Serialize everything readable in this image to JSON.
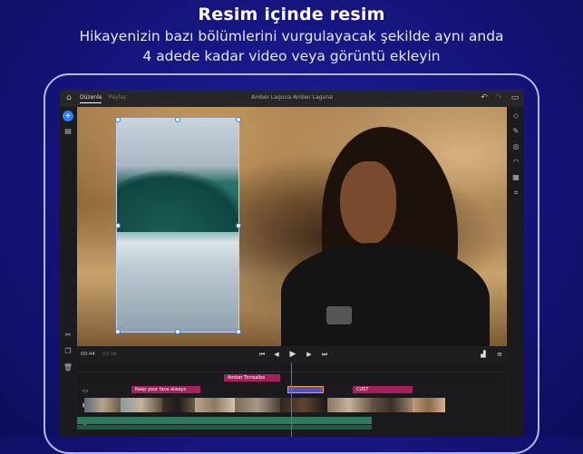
{
  "headline": {
    "title": "Resim içinde resim",
    "line1": "Hikayenizin bazı bölümlerini vurgulayacak şekilde aynı anda",
    "line2": "4 adede kadar video veya görüntü ekleyin"
  },
  "app": {
    "tabs": [
      {
        "label": "Düzenle",
        "active": true
      },
      {
        "label": "Paylaş",
        "active": false
      }
    ],
    "project_title": "Amber Laguna  Amber Laguna",
    "icons": {
      "home": "home-icon",
      "undo": "undo-icon",
      "redo": "redo-icon",
      "comments": "comment-icon"
    }
  },
  "playback": {
    "current_time": "00:44",
    "total_time": "00:56"
  },
  "timeline": {
    "title_clips": [
      {
        "label": "Amber Torrealba",
        "color": "#a5205c"
      },
      {
        "label": "Keep your face always",
        "color": "#a5205c"
      },
      {
        "label": "CUST",
        "color": "#a5205c"
      }
    ]
  },
  "colors": {
    "background": "#14147a",
    "accent": "#2d7ff9",
    "title_clip": "#a5205c",
    "audio": "#2d7a5d"
  }
}
